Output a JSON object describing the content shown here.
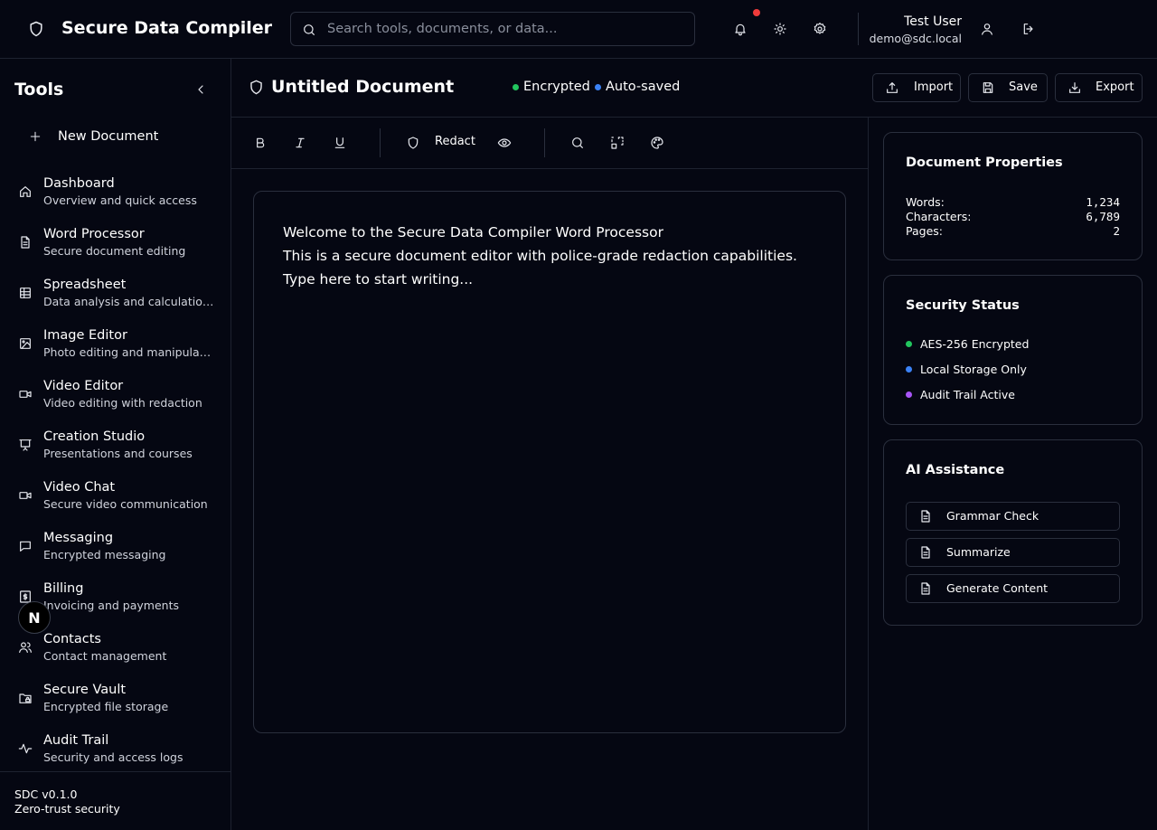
{
  "app": {
    "title": "Secure Data Compiler",
    "brand_icon": "shield-icon"
  },
  "search": {
    "placeholder": "Search tools, documents, or data...",
    "value": ""
  },
  "user": {
    "name": "Test User",
    "email": "demo@sdc.local"
  },
  "topbar_icons": [
    "bell-icon",
    "sun-icon",
    "gear-icon",
    "user-icon",
    "logout-icon"
  ],
  "sidebar": {
    "title": "Tools",
    "new_document_label": "New Document",
    "items": [
      {
        "label": "Dashboard",
        "desc": "Overview and quick access",
        "icon": "home-icon"
      },
      {
        "label": "Word Processor",
        "desc": "Secure document editing",
        "icon": "file-text-icon"
      },
      {
        "label": "Spreadsheet",
        "desc": "Data analysis and calculations",
        "icon": "table-icon"
      },
      {
        "label": "Image Editor",
        "desc": "Photo editing and manipulation",
        "icon": "image-icon"
      },
      {
        "label": "Video Editor",
        "desc": "Video editing with redaction",
        "icon": "video-icon"
      },
      {
        "label": "Creation Studio",
        "desc": "Presentations and courses",
        "icon": "presentation-icon"
      },
      {
        "label": "Video Chat",
        "desc": "Secure video communication",
        "icon": "video-chat-icon"
      },
      {
        "label": "Messaging",
        "desc": "Encrypted messaging",
        "icon": "message-icon"
      },
      {
        "label": "Billing",
        "desc": "Invoicing and payments",
        "icon": "receipt-icon"
      },
      {
        "label": "Contacts",
        "desc": "Contact management",
        "icon": "users-icon"
      },
      {
        "label": "Secure Vault",
        "desc": "Encrypted file storage",
        "icon": "folder-lock-icon"
      },
      {
        "label": "Audit Trail",
        "desc": "Security and access logs",
        "icon": "activity-icon"
      }
    ],
    "footer_version": "SDC v0.1.0",
    "footer_tagline": "Zero-trust security",
    "badge_letter": "N"
  },
  "document": {
    "title": "Untitled Document",
    "status_encrypted": "Encrypted",
    "status_autosaved": "Auto-saved",
    "import_label": "Import",
    "save_label": "Save",
    "export_label": "Export",
    "content": [
      "Welcome to the Secure Data Compiler Word Processor",
      "This is a secure document editor with police-grade redaction capabilities.",
      "Type here to start writing..."
    ]
  },
  "toolbar": {
    "redact_label": "Redact",
    "icons": [
      "bold-icon",
      "italic-icon",
      "underline-icon",
      "shield-icon",
      "eye-icon",
      "search-icon",
      "scan-icon",
      "palette-icon"
    ]
  },
  "properties": {
    "title": "Document Properties",
    "words_label": "Words:",
    "words_value": "1,234",
    "characters_label": "Characters:",
    "characters_value": "6,789",
    "pages_label": "Pages:",
    "pages_value": "2"
  },
  "security": {
    "title": "Security Status",
    "items": [
      {
        "label": "AES-256 Encrypted",
        "color": "#22c55e"
      },
      {
        "label": "Local Storage Only",
        "color": "#3b82f6"
      },
      {
        "label": "Audit Trail Active",
        "color": "#a855f7"
      }
    ]
  },
  "ai": {
    "title": "AI Assistance",
    "buttons": [
      "Grammar Check",
      "Summarize",
      "Generate Content"
    ]
  },
  "colors": {
    "background": "#050712",
    "border": "#2a2f3d",
    "encrypted_dot": "#22c55e",
    "autosaved_dot": "#3b82f6",
    "notification_dot": "#ef3b3b"
  }
}
